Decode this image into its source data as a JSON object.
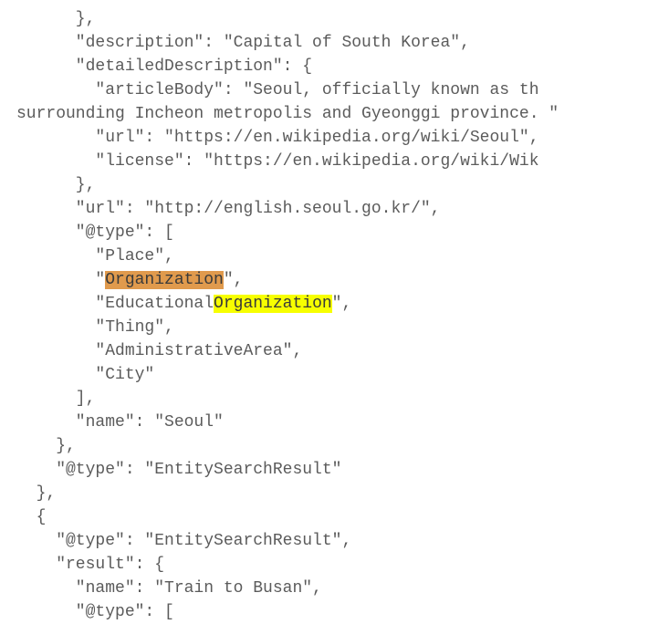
{
  "code": {
    "line01": "      },",
    "line02": "      \"description\": \"Capital of South Korea\",",
    "line03": "      \"detailedDescription\": {",
    "line04": "        \"articleBody\": \"Seoul, officially known as th",
    "line05": "surrounding Incheon metropolis and Gyeonggi province. \"",
    "line06": "        \"url\": \"https://en.wikipedia.org/wiki/Seoul\",",
    "line07": "        \"license\": \"https://en.wikipedia.org/wiki/Wik",
    "line08": "      },",
    "line09": "      \"url\": \"http://english.seoul.go.kr/\",",
    "line10": "      \"@type\": [",
    "line11": "        \"Place\",",
    "line12a": "        \"",
    "line12b": "Organization",
    "line12c": "\",",
    "line13a": "        \"Educational",
    "line13b": "Organization",
    "line13c": "\",",
    "line14": "        \"Thing\",",
    "line15": "        \"AdministrativeArea\",",
    "line16": "        \"City\"",
    "line17": "      ],",
    "line18": "      \"name\": \"Seoul\"",
    "line19": "    },",
    "line20": "    \"@type\": \"EntitySearchResult\"",
    "line21": "  },",
    "line22": "  {",
    "line23": "    \"@type\": \"EntitySearchResult\",",
    "line24": "    \"result\": {",
    "line25": "      \"name\": \"Train to Busan\",",
    "line26": "      \"@type\": ["
  }
}
